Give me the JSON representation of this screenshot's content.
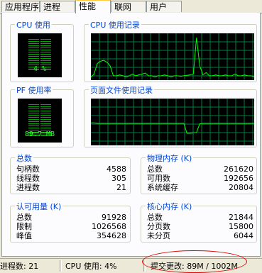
{
  "tabs": [
    {
      "label": "应用程序",
      "active": false
    },
    {
      "label": "进程",
      "active": false
    },
    {
      "label": "性能",
      "active": true
    },
    {
      "label": "联网",
      "active": false
    },
    {
      "label": "用户",
      "active": false
    }
  ],
  "cpu_usage": {
    "label": "CPU 使用",
    "value_text": "4 %",
    "level_percent": 4
  },
  "cpu_history": {
    "label": "CPU 使用记录",
    "series_percent": [
      5,
      12,
      35,
      40,
      42,
      38,
      30,
      8,
      8,
      10,
      8,
      6,
      8,
      12,
      8,
      10,
      12,
      14,
      8,
      8,
      6,
      8,
      8,
      10,
      8,
      6,
      8,
      8,
      7,
      8,
      9,
      10,
      12,
      92,
      30,
      10,
      15,
      8,
      8,
      10,
      8,
      8,
      10,
      8,
      8,
      12,
      8,
      8,
      10,
      8,
      8,
      6
    ]
  },
  "pf_usage": {
    "label": "PF 使用率",
    "value_text": "89.7 MB",
    "level_percent": 10
  },
  "pf_history": {
    "label": "页面文件使用记录",
    "series_percent": [
      48,
      48,
      47,
      47,
      47,
      47,
      47,
      47,
      47,
      47,
      47,
      47,
      47,
      47,
      47,
      47,
      47,
      47,
      47,
      47,
      47,
      47,
      47,
      47,
      47,
      47,
      47,
      47,
      47,
      47,
      25,
      25,
      26,
      27,
      46,
      47,
      47,
      47,
      47,
      47,
      47,
      47,
      47,
      47,
      47,
      47,
      47,
      47,
      47,
      47,
      47,
      47
    ]
  },
  "totals": {
    "label": "总数",
    "rows": [
      {
        "key": "句柄数",
        "value": "4588"
      },
      {
        "key": "线程数",
        "value": "305"
      },
      {
        "key": "进程数",
        "value": "21"
      }
    ]
  },
  "physical_memory": {
    "label": "物理内存 (K)",
    "rows": [
      {
        "key": "总数",
        "value": "261620"
      },
      {
        "key": "可用数",
        "value": "192656"
      },
      {
        "key": "系统缓存",
        "value": "20804"
      }
    ]
  },
  "commit_charge": {
    "label": "认可用量 (K)",
    "rows": [
      {
        "key": "总数",
        "value": "91928"
      },
      {
        "key": "限制",
        "value": "1026568"
      },
      {
        "key": "峰值",
        "value": "354628"
      }
    ]
  },
  "kernel_memory": {
    "label": "核心内存 (K)",
    "rows": [
      {
        "key": "总数",
        "value": "21844"
      },
      {
        "key": "分页数",
        "value": "15800"
      },
      {
        "key": "未分页",
        "value": "6044"
      }
    ]
  },
  "status_bar": {
    "processes": "进程数: 21",
    "cpu": "CPU 使用: 4%",
    "commit": "提交更改: 89M / 1002M"
  },
  "colors": {
    "accent": "#0046D5",
    "graph_line": "#00FF00",
    "grid": "#008040",
    "annotation": "#E00000"
  }
}
